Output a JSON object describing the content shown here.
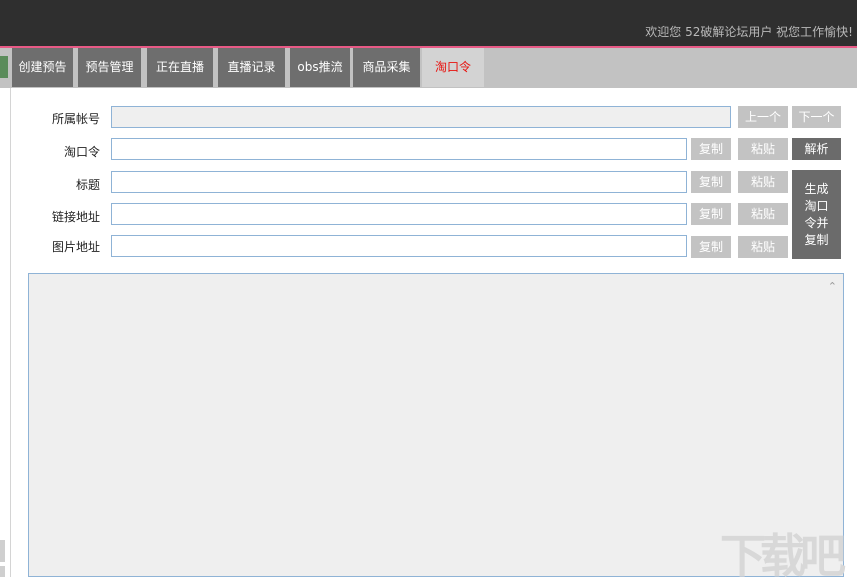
{
  "header": {
    "welcome": "欢迎您 52破解论坛用户 祝您工作愉快!"
  },
  "tabs": [
    {
      "label": "创建预告"
    },
    {
      "label": "预告管理"
    },
    {
      "label": "正在直播"
    },
    {
      "label": "直播记录"
    },
    {
      "label": "obs推流"
    },
    {
      "label": "商品采集"
    },
    {
      "label": "淘口令",
      "active": true
    }
  ],
  "form": {
    "account_label": "所属帐号",
    "account_value": "",
    "prev_button": "上一个",
    "next_button": "下一个",
    "taokouling_label": "淘口令",
    "taokouling_value": "",
    "title_label": "标题",
    "title_value": "",
    "link_label": "链接地址",
    "link_value": "",
    "image_label": "图片地址",
    "image_value": "",
    "copy_button": "复制",
    "paste_button": "粘贴",
    "parse_button": "解析",
    "generate_button": "生成淘口令并复制"
  },
  "output": {
    "value": ""
  },
  "watermark": {
    "text": "下载吧"
  },
  "colors": {
    "topbar": "#2f2f2f",
    "accent_line": "#e85a86",
    "tab_bg": "#6e6e6e",
    "tab_active_text": "#e8120e",
    "button_light": "#c3c3c3",
    "button_dark": "#6b6b6b",
    "field_border": "#8fb3d6"
  }
}
